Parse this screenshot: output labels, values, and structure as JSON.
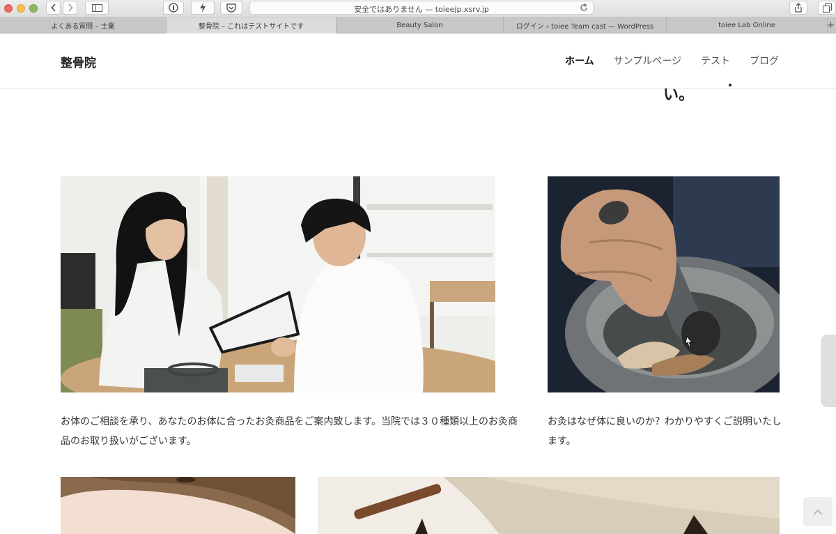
{
  "browser": {
    "address_text": "安全ではありません — toieejp.xsrv.jp",
    "tabs": [
      {
        "label": "よくある質問 – 士業"
      },
      {
        "label": "整骨院 – これはテストサイトです"
      },
      {
        "label": "Beauty Salon"
      },
      {
        "label": "ログイン ‹ toiee Team cast — WordPress"
      },
      {
        "label": "toiee Lab Online"
      }
    ],
    "new_tab": "+"
  },
  "site": {
    "title": "整骨院",
    "nav": [
      "ホーム",
      "サンプルページ",
      "テスト",
      "ブログ"
    ],
    "stray_text": "い。"
  },
  "cards": [
    {
      "caption": "お体のご相談を承り、あなたのお体に合ったお灸商品をご案内致します。当院では３０種類以上のお灸商品のお取り扱いがございます。",
      "image": "consultation-photo"
    },
    {
      "caption": "お灸はなぜ体に良いのか？わかりやすくご説明いたします。",
      "image": "mortar-and-pestle-photo"
    }
  ],
  "icons": [
    "back-icon",
    "forward-icon",
    "sidebar-icon",
    "onepassword-icon",
    "bolt-icon",
    "pocket-icon",
    "reload-icon",
    "share-icon",
    "tabs-icon",
    "arrow-up-icon"
  ]
}
